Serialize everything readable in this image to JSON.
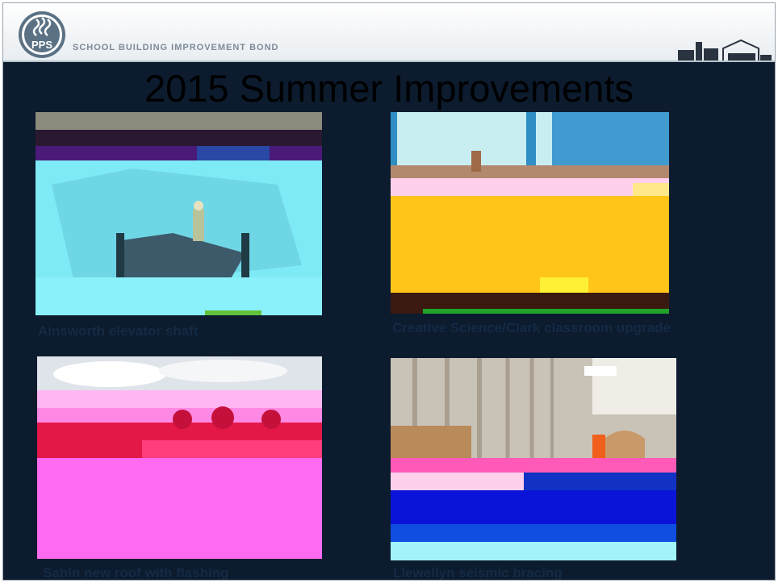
{
  "header": {
    "logo_text": "PPS",
    "bond_label": "SCHOOL BUILDING IMPROVEMENT BOND"
  },
  "slide": {
    "title": "2015 Summer Improvements"
  },
  "photos": [
    {
      "caption": "Ainsworth elevator shaft",
      "alt": "construction crew in elevator shaft excavation"
    },
    {
      "caption": "Creative Science/Clark classroom upgrade",
      "alt": "classroom wall under renovation"
    },
    {
      "caption": "Sabin new roof with flashing",
      "alt": "rooftop with new flashing and trees"
    },
    {
      "caption": "Llewellyn seismic bracing",
      "alt": "hallway with metal seismic bracing"
    }
  ],
  "colors": {
    "slide_background": "#0c1b2e",
    "caption_color": "#142a44",
    "accent": "#5b7184"
  }
}
